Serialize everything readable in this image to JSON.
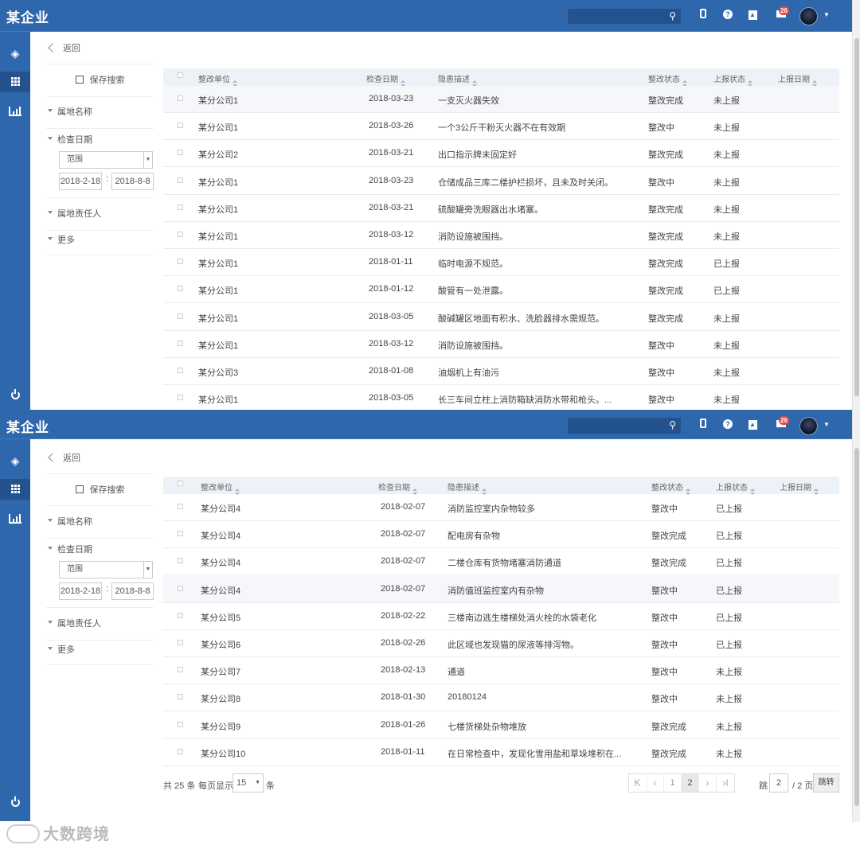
{
  "app": {
    "title": "某企业"
  },
  "nav": {
    "back_label": "返回",
    "save_search_label": "保存搜索"
  },
  "filters": {
    "owner_name_label": "属地名称",
    "check_date_label": "检查日期",
    "range_option": "范围",
    "date_from": "2018-2-18",
    "date_sep": ":",
    "date_to": "2018-8-8",
    "owner_person_label": "属地责任人",
    "more_label": "更多"
  },
  "topbar": {
    "mail_count": "26"
  },
  "table": {
    "columns": [
      "整改单位",
      "检查日期",
      "隐患描述",
      "整改状态",
      "上报状态",
      "上报日期"
    ],
    "page1_rows": [
      [
        "某分公司1",
        "2018-03-23",
        "一支灭火器失效",
        "整改完成",
        "未上报",
        ""
      ],
      [
        "某分公司1",
        "2018-03-26",
        "一个3公斤干粉灭火器不在有效期",
        "整改中",
        "未上报",
        ""
      ],
      [
        "某分公司2",
        "2018-03-21",
        "出口指示牌未固定好",
        "整改完成",
        "未上报",
        ""
      ],
      [
        "某分公司1",
        "2018-03-23",
        "仓储成品三库二楼护栏损坏，且未及时关闭。",
        "整改中",
        "未上报",
        ""
      ],
      [
        "某分公司1",
        "2018-03-21",
        "硫酸罐旁洗眼器出水堵塞。",
        "整改完成",
        "未上报",
        ""
      ],
      [
        "某分公司1",
        "2018-03-12",
        "消防设施被围挡。",
        "整改完成",
        "未上报",
        ""
      ],
      [
        "某分公司1",
        "2018-01-11",
        "临时电源不规范。",
        "整改完成",
        "已上报",
        ""
      ],
      [
        "某分公司1",
        "2018-01-12",
        "酸管有一处泄露。",
        "整改完成",
        "已上报",
        ""
      ],
      [
        "某分公司1",
        "2018-03-05",
        "酸碱罐区地面有积水、洗脸器排水需规范。",
        "整改完成",
        "未上报",
        ""
      ],
      [
        "某分公司1",
        "2018-03-12",
        "消防设施被围挡。",
        "整改中",
        "未上报",
        ""
      ],
      [
        "某分公司3",
        "2018-01-08",
        "油烟机上有油污",
        "整改中",
        "未上报",
        ""
      ],
      [
        "某分公司1",
        "2018-03-05",
        "长三车间立柱上消防箱缺消防水带和枪头。...",
        "整改中",
        "未上报",
        ""
      ]
    ],
    "page2_rows": [
      [
        "某分公司4",
        "2018-02-07",
        "消防监控室内杂物较多",
        "整改中",
        "已上报",
        ""
      ],
      [
        "某分公司4",
        "2018-02-07",
        "配电房有杂物",
        "整改完成",
        "已上报",
        ""
      ],
      [
        "某分公司4",
        "2018-02-07",
        "二楼仓库有货物堵塞消防通道",
        "整改完成",
        "已上报",
        ""
      ],
      [
        "某分公司4",
        "2018-02-07",
        "消防值班监控室内有杂物",
        "整改中",
        "已上报",
        ""
      ],
      [
        "某分公司5",
        "2018-02-22",
        "三楼南边逃生楼梯处消火栓的水袋老化",
        "整改中",
        "已上报",
        ""
      ],
      [
        "某分公司6",
        "2018-02-26",
        "此区域也发现猫的尿液等排泻物。",
        "整改中",
        "已上报",
        ""
      ],
      [
        "某分公司7",
        "2018-02-13",
        "通道",
        "整改中",
        "未上报",
        ""
      ],
      [
        "某分公司8",
        "2018-01-30",
        "20180124",
        "整改中",
        "未上报",
        ""
      ],
      [
        "某分公司9",
        "2018-01-26",
        "七楼货梯处杂物堆放",
        "整改完成",
        "未上报",
        ""
      ],
      [
        "某分公司10",
        "2018-01-11",
        "在日常检查中，发现化雪用盐和草垛堆积在...",
        "整改完成",
        "未上报",
        ""
      ]
    ]
  },
  "pager": {
    "total": "共 25 条",
    "per_page_prefix": "每页显示",
    "per_page": "15",
    "per_page_suffix": "条",
    "first": "K",
    "prev": "‹",
    "pages": [
      "1",
      "2"
    ],
    "next": "›",
    "last": "›I",
    "jump_label": "跳",
    "jump_value": "2",
    "page_count": "/ 2 页",
    "go_label": "跳转"
  },
  "watermark": "大数跨境",
  "colors": {
    "header": "#2f67ad",
    "nav_active": "#24528e",
    "table_header": "#edf2f8"
  },
  "icons": [
    "search-icon",
    "phone-icon",
    "help-icon",
    "user-icon",
    "mail-icon",
    "layers-icon",
    "grid-icon",
    "chart-icon",
    "power-icon",
    "save-icon",
    "back-icon"
  ]
}
